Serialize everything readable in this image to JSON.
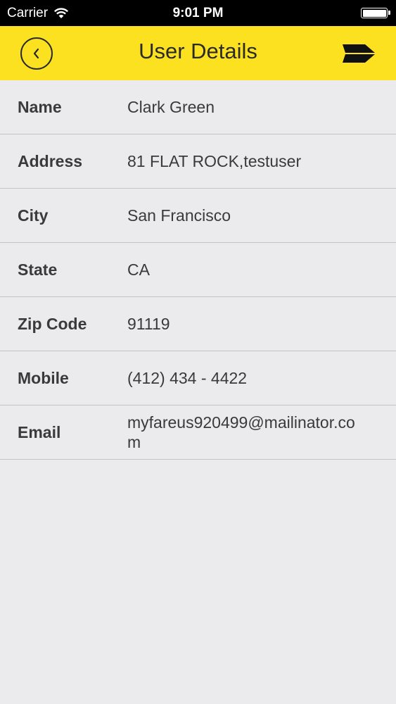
{
  "status_bar": {
    "carrier": "Carrier",
    "time": "9:01 PM",
    "battery_level": 1.0
  },
  "nav": {
    "title": "User Details",
    "back_icon": "chevron-left-circle-icon",
    "menu_icon": "flag-arrow-icon"
  },
  "details": [
    {
      "label": "Name",
      "value": "Clark Green"
    },
    {
      "label": "Address",
      "value": "81 FLAT ROCK,testuser"
    },
    {
      "label": "City",
      "value": "San Francisco"
    },
    {
      "label": "State",
      "value": "CA"
    },
    {
      "label": "Zip Code",
      "value": "91119"
    },
    {
      "label": "Mobile",
      "value": "(412) 434 - 4422"
    },
    {
      "label": "Email",
      "value": "myfareus920499@mailinator.com"
    }
  ],
  "colors": {
    "nav_background": "#fbe11f",
    "page_background": "#ebebed",
    "status_bar": "#000000"
  }
}
